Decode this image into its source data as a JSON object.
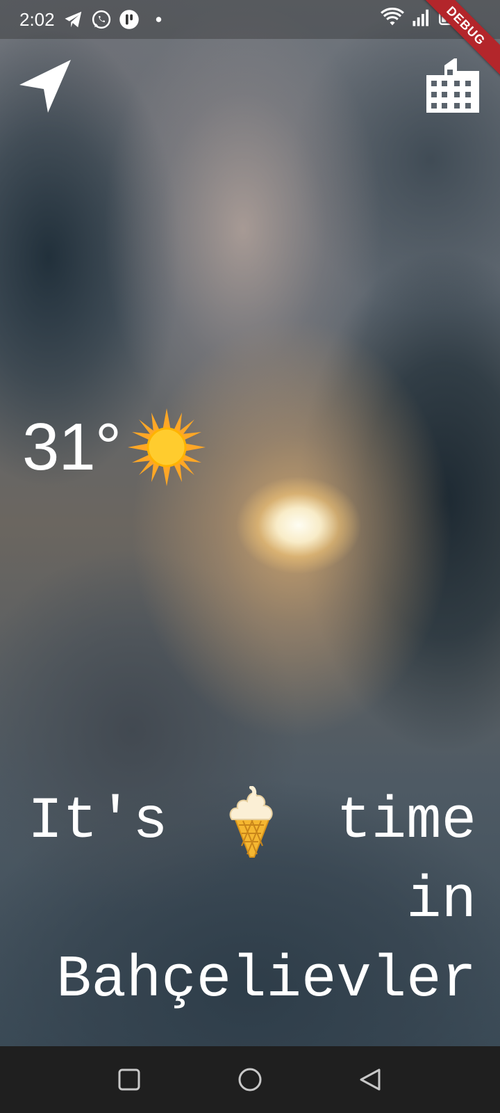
{
  "status_bar": {
    "time": "2:02",
    "icons_left": [
      "telegram-icon",
      "whatsapp-icon",
      "app-icon",
      "notification-dot-icon"
    ],
    "icons_right": [
      "wifi-icon",
      "signal-icon",
      "battery-icon"
    ]
  },
  "debug_banner": "DEBUG",
  "top_actions": {
    "location_icon": "navigation-arrow-icon",
    "city_icon": "city-buildings-icon"
  },
  "weather": {
    "temperature": "31°",
    "condition_icon": "sun-icon"
  },
  "message": {
    "word_its": "It's",
    "emoji": "ice-cream-icon",
    "word_time": "time",
    "word_in": "in",
    "city": "Bahçelievler"
  },
  "nav_bar": {
    "buttons": [
      "recents-square-icon",
      "home-circle-icon",
      "back-triangle-icon"
    ]
  },
  "colors": {
    "text": "#ffffff",
    "nav_bar": "#1f1f1f",
    "debug_ribbon": "#b3262b",
    "sun": "#ffcc2e"
  }
}
